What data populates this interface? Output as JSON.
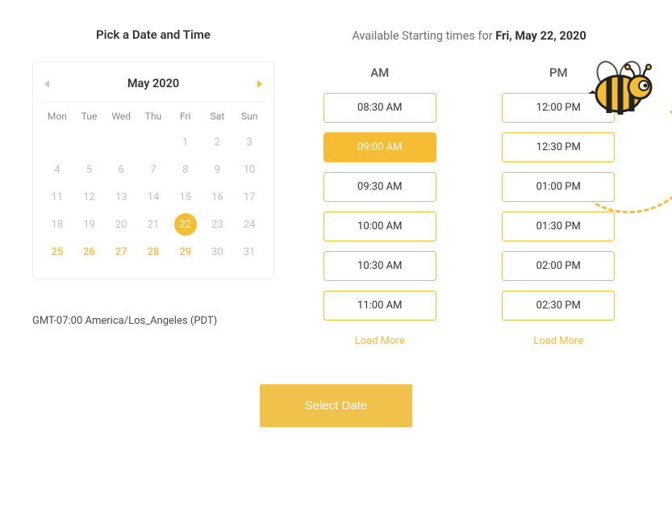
{
  "titles": {
    "pick": "Pick a Date and Time",
    "avail_prefix": "Available Starting times for ",
    "avail_date": "Fri, May 22, 2020"
  },
  "calendar": {
    "month_label": "May   2020",
    "dow": [
      "Mon",
      "Tue",
      "Wed",
      "Thu",
      "Fri",
      "Sat",
      "Sun"
    ],
    "weeks": [
      [
        null,
        null,
        null,
        null,
        {
          "d": 1
        },
        {
          "d": 2
        },
        {
          "d": 3
        }
      ],
      [
        {
          "d": 4
        },
        {
          "d": 5
        },
        {
          "d": 6
        },
        {
          "d": 7
        },
        {
          "d": 8
        },
        {
          "d": 9
        },
        {
          "d": 10
        }
      ],
      [
        {
          "d": 11
        },
        {
          "d": 12
        },
        {
          "d": 13
        },
        {
          "d": 14
        },
        {
          "d": 15
        },
        {
          "d": 16
        },
        {
          "d": 17
        }
      ],
      [
        {
          "d": 18
        },
        {
          "d": 19
        },
        {
          "d": 20
        },
        {
          "d": 21
        },
        {
          "d": 22,
          "sel": true
        },
        {
          "d": 23
        },
        {
          "d": 24
        }
      ],
      [
        {
          "d": 25,
          "a": true
        },
        {
          "d": 26,
          "a": true
        },
        {
          "d": 27,
          "a": true
        },
        {
          "d": 28,
          "a": true
        },
        {
          "d": 29,
          "a": true
        },
        {
          "d": 30
        },
        {
          "d": 31
        }
      ]
    ]
  },
  "timezone": "GMT-07:00 America/Los_Angeles (PDT)",
  "times": {
    "am_label": "AM",
    "pm_label": "PM",
    "am": [
      {
        "t": "08:30 AM"
      },
      {
        "t": "09:00 AM",
        "sel": true
      },
      {
        "t": "09:30 AM"
      },
      {
        "t": "10:00 AM"
      },
      {
        "t": "10:30 AM"
      },
      {
        "t": "11:00 AM"
      }
    ],
    "pm": [
      {
        "t": "12:00 PM"
      },
      {
        "t": "12:30 PM"
      },
      {
        "t": "01:00 PM"
      },
      {
        "t": "01:30 PM"
      },
      {
        "t": "02:00 PM"
      },
      {
        "t": "02:30 PM"
      }
    ],
    "load_more": "Load More"
  },
  "select_btn": "Select Date"
}
